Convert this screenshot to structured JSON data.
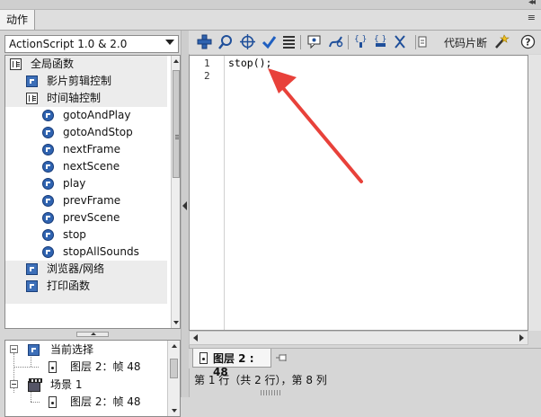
{
  "panel": {
    "tab_label": "动作",
    "menu_icon": "≡"
  },
  "version_select": {
    "value": "ActionScript 1.0 & 2.0"
  },
  "toolbox": {
    "items": [
      {
        "label": "全局函数",
        "icon": "book-icon",
        "indent": 0
      },
      {
        "label": "影片剪辑控制",
        "icon": "book-arrow-icon",
        "indent": 1
      },
      {
        "label": "时间轴控制",
        "icon": "book-icon",
        "indent": 1
      },
      {
        "label": "gotoAndPlay",
        "icon": "action-icon",
        "indent": 2
      },
      {
        "label": "gotoAndStop",
        "icon": "action-icon",
        "indent": 2
      },
      {
        "label": "nextFrame",
        "icon": "action-icon",
        "indent": 2
      },
      {
        "label": "nextScene",
        "icon": "action-icon",
        "indent": 2
      },
      {
        "label": "play",
        "icon": "action-icon",
        "indent": 2
      },
      {
        "label": "prevFrame",
        "icon": "action-icon",
        "indent": 2
      },
      {
        "label": "prevScene",
        "icon": "action-icon",
        "indent": 2
      },
      {
        "label": "stop",
        "icon": "action-icon",
        "indent": 2
      },
      {
        "label": "stopAllSounds",
        "icon": "action-icon",
        "indent": 2
      },
      {
        "label": "浏览器/网络",
        "icon": "book-arrow-icon",
        "indent": 1
      },
      {
        "label": "打印函数",
        "icon": "book-arrow-icon",
        "indent": 1
      }
    ]
  },
  "script_navigator": {
    "items": [
      {
        "label": "当前选择",
        "icon": "book-arrow-icon",
        "level": 0
      },
      {
        "label": "图层 2：帧 48",
        "icon": "frame-icon",
        "level": 1
      },
      {
        "label": "场景 1",
        "icon": "scene-icon",
        "level": 0
      },
      {
        "label": "图层 2：帧 48",
        "icon": "frame-icon",
        "level": 1
      }
    ]
  },
  "toolbar": {
    "code_snippets_label": "代码片断",
    "buttons": [
      "add-icon",
      "find-icon",
      "target-icon",
      "check-syntax-icon",
      "auto-format-icon",
      "code-hint-icon",
      "debug-icon",
      "collapse-braces-icon",
      "collapse-selection-icon",
      "expand-all-icon",
      "code-snippets-icon",
      "script-assist-icon",
      "help-icon"
    ]
  },
  "editor": {
    "line_numbers": [
      "1",
      "2"
    ],
    "lines": [
      "stop();",
      ""
    ]
  },
  "bottom_tab": {
    "label": "图层 2 : 48"
  },
  "status": {
    "text": "第 1 行（共 2 行），第 8 列"
  },
  "colors": {
    "annotation_arrow": "#e8413a",
    "icon_blue": "#2f63b0"
  }
}
